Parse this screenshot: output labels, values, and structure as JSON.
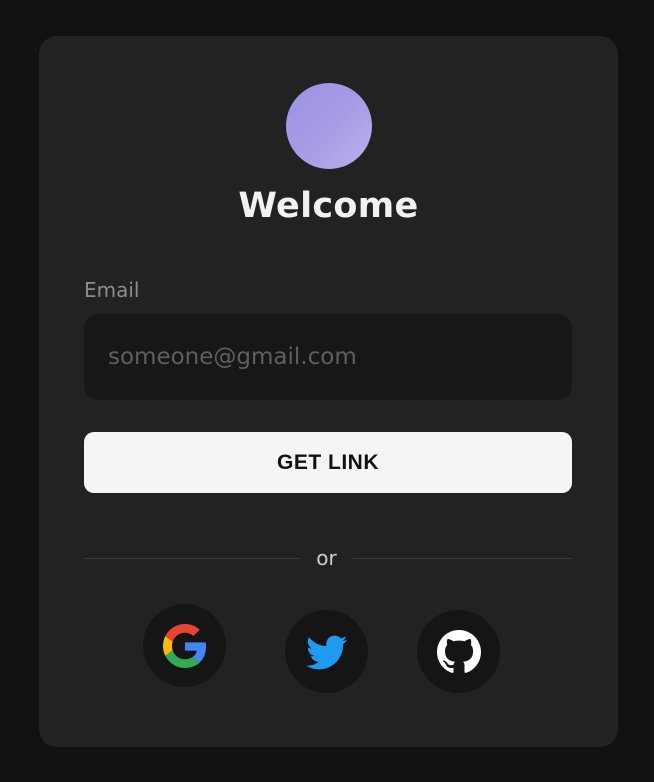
{
  "card": {
    "title": "Welcome"
  },
  "form": {
    "email_label": "Email",
    "email_value": "",
    "email_placeholder": "someone@gmail.com",
    "submit_label": "GET LINK"
  },
  "divider": {
    "text": "or"
  },
  "social": [
    {
      "provider": "google",
      "icon": "google-icon"
    },
    {
      "provider": "twitter",
      "icon": "twitter-icon"
    },
    {
      "provider": "github",
      "icon": "github-icon"
    }
  ],
  "colors": {
    "background": "#111111",
    "card": "#222222",
    "avatar": "#a79be6",
    "button": "#f5f5f5",
    "twitter": "#1d9bf0"
  }
}
